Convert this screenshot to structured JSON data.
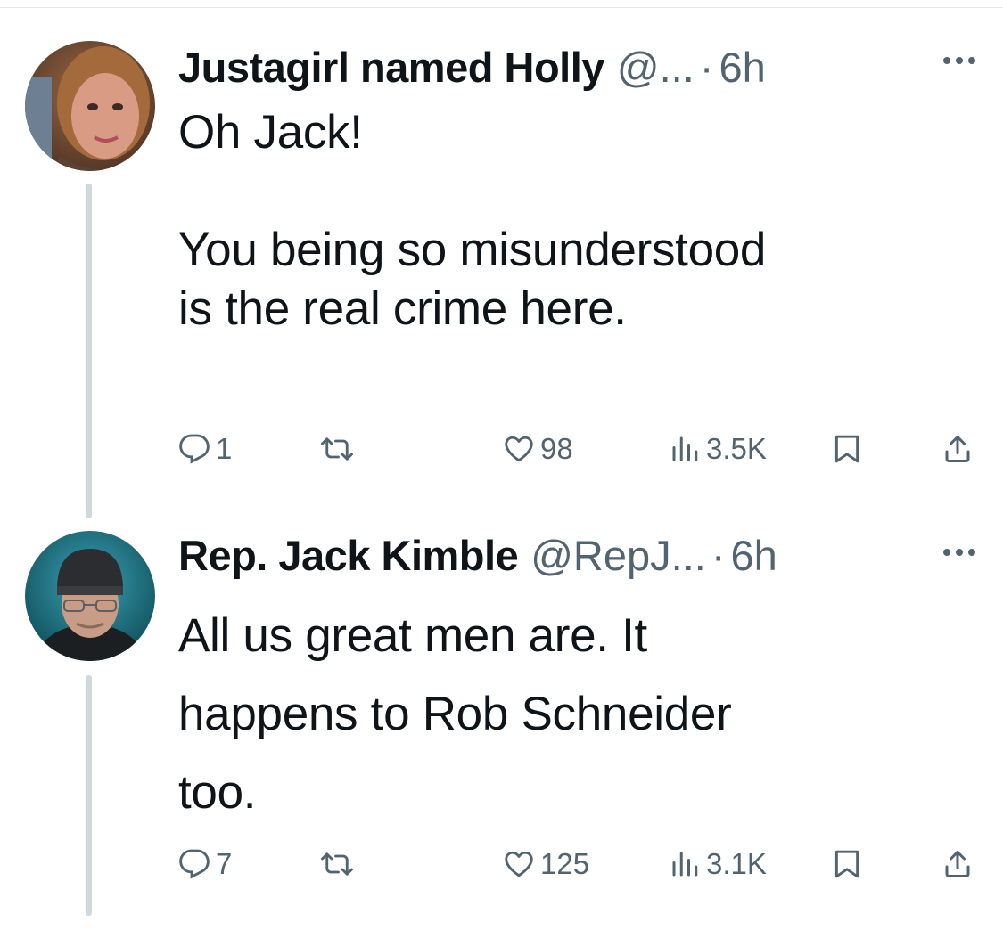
{
  "tweets": [
    {
      "name": "Justagirl named Holly",
      "handle": "@...",
      "separator": "·",
      "time": "6h",
      "text": "Oh Jack!\n\nYou being so misunderstood\nis the real crime here.",
      "replies": "1",
      "retweets": "",
      "likes": "98",
      "views": "3.5K"
    },
    {
      "name": "Rep. Jack Kimble",
      "handle": "@RepJ...",
      "separator": "·",
      "time": "6h",
      "text": "All us great men are. It\nhappens to Rob Schneider\ntoo.",
      "replies": "7",
      "retweets": "",
      "likes": "125",
      "views": "3.1K"
    }
  ],
  "icons": {
    "reply": "reply-icon",
    "retweet": "retweet-icon",
    "like": "heart-icon",
    "views": "views-icon",
    "bookmark": "bookmark-icon",
    "share": "share-icon",
    "more": "more-icon"
  },
  "colors": {
    "text": "#0f1419",
    "secondary": "#536471",
    "thread_line": "#cfd9de"
  }
}
